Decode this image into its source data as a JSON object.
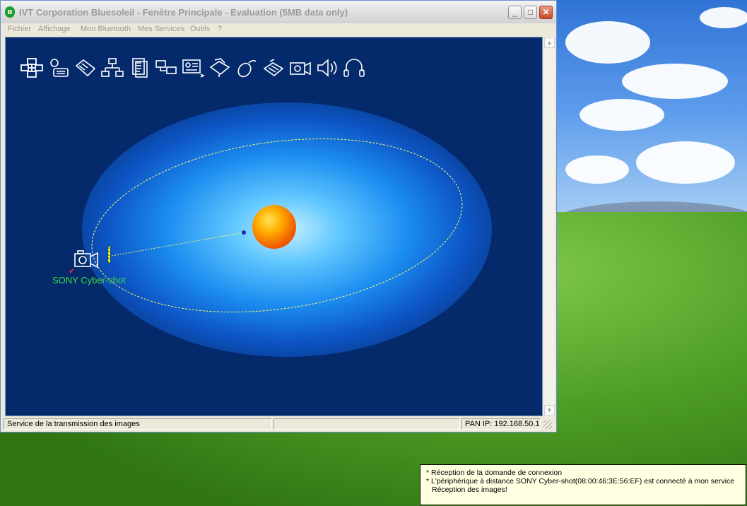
{
  "window": {
    "title": "IVT Corporation Bluesoleil - Fenêtre Principale - Evaluation (5MB data only)",
    "minimize_label": "_",
    "maximize_label": "□",
    "close_label": "✕"
  },
  "menu": {
    "items": [
      "Fichier",
      "Affichage",
      "Mon Bluetooth",
      "Mes Services",
      "Outils",
      "?"
    ]
  },
  "toolbar": {
    "service_icons": [
      "pan-network-icon",
      "dialup-icon",
      "fax-icon",
      "lan-access-icon",
      "file-transfer-icon",
      "sync-icon",
      "business-card-icon",
      "printer-icon",
      "mouse-icon",
      "serial-fax-icon",
      "imaging-camera-icon",
      "audio-speaker-icon",
      "headset-icon"
    ]
  },
  "main": {
    "device_label": "SONY Cyber-shot",
    "device_icon": "camera-device-icon",
    "check_mark": "✓",
    "colors": {
      "background": "#042a6b",
      "orbit": "#ffff66",
      "device_label": "#3fdc3f"
    }
  },
  "statusbar": {
    "service_text": "Service de la transmission des images",
    "middle_text": "",
    "ip_text": "PAN IP: 192.168.50.1"
  },
  "notification": {
    "lines": [
      "* Réception de la domande de connexion",
      "* L'périphérique à distance SONY Cyber-shot(08:00:46:3E:56:EF) est connecté à mon service",
      "Réception des images!"
    ]
  }
}
